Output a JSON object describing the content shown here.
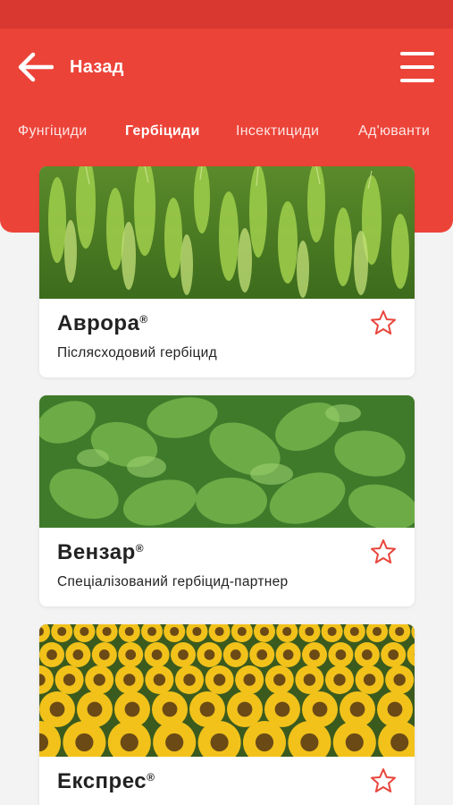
{
  "header": {
    "back_label": "Назад",
    "accent_color": "#ec4338",
    "status_color": "#d8382f"
  },
  "tabs": [
    {
      "label": "Фунгіциди",
      "active": false
    },
    {
      "label": "Гербіциди",
      "active": true
    },
    {
      "label": "Інсектициди",
      "active": false
    },
    {
      "label": "Ад'юванти",
      "active": false
    }
  ],
  "products": [
    {
      "name": "Аврора",
      "mark": "®",
      "subtitle": "Післясходовий гербіцид",
      "image": "wheat-field"
    },
    {
      "name": "Вензар",
      "mark": "®",
      "subtitle": "Спеціалізований гербіцид-партнер",
      "image": "sugar-beet-field"
    },
    {
      "name": "Експрес",
      "mark": "®",
      "subtitle": "",
      "image": "sunflower-field"
    }
  ],
  "icons": {
    "back": "arrow-left-icon",
    "menu": "hamburger-menu-icon",
    "favorite": "star-outline-icon"
  }
}
